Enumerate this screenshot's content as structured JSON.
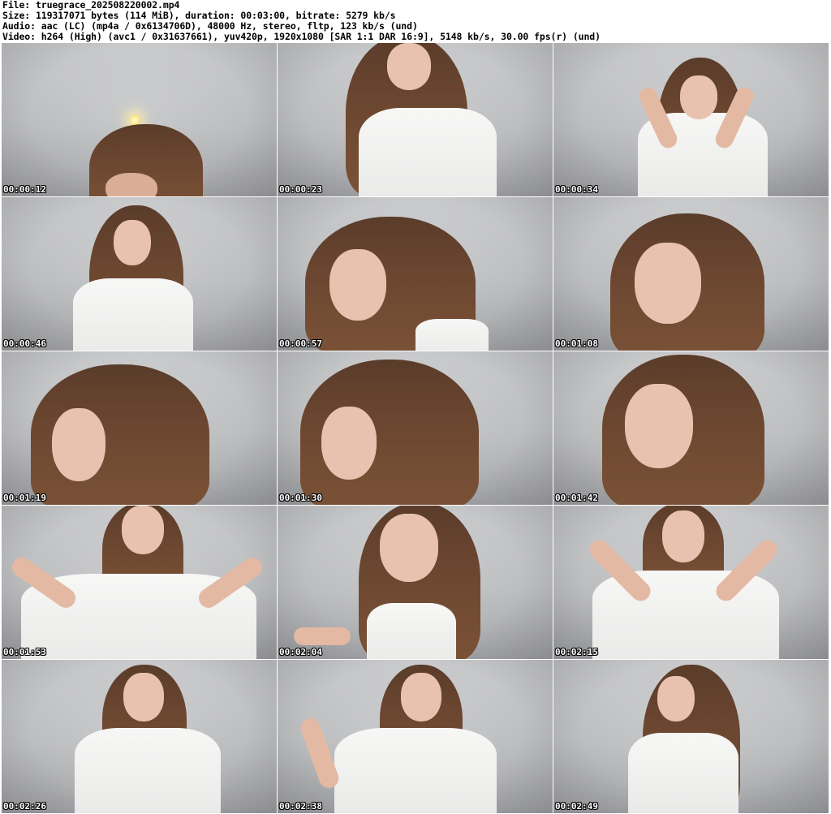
{
  "header": {
    "file_line": "File: truegrace_202508220002.mp4",
    "size_line": "Size: 119317071 bytes (114 MiB), duration: 00:03:00, bitrate: 5279 kb/s",
    "audio_line": "Audio: aac (LC) (mp4a / 0x6134706D), 48000 Hz, stereo, fltp, 123 kb/s (und)",
    "video_line": "Video: h264 (High) (avc1 / 0x31637661), yuv420p, 1920x1080 [SAR 1:1 DAR 16:9], 5148 kb/s, 30.00 fps(r) (und)"
  },
  "thumbnails": [
    {
      "timestamp": "00:00:12"
    },
    {
      "timestamp": "00:00:23"
    },
    {
      "timestamp": "00:00:34"
    },
    {
      "timestamp": "00:00:46"
    },
    {
      "timestamp": "00:00:57"
    },
    {
      "timestamp": "00:01:08"
    },
    {
      "timestamp": "00:01:19"
    },
    {
      "timestamp": "00:01:30"
    },
    {
      "timestamp": "00:01:42"
    },
    {
      "timestamp": "00:01:53"
    },
    {
      "timestamp": "00:02:04"
    },
    {
      "timestamp": "00:02:15"
    },
    {
      "timestamp": "00:02:26"
    },
    {
      "timestamp": "00:02:38"
    },
    {
      "timestamp": "00:02:49"
    }
  ],
  "colors": {
    "background": "#ffffff",
    "header_text": "#000000",
    "timestamp_text": "#ffffff",
    "wall": "#bfc0c2",
    "hair": "#6b4630",
    "shirt": "#f4f4f3",
    "skin": "#e8c2ae"
  }
}
